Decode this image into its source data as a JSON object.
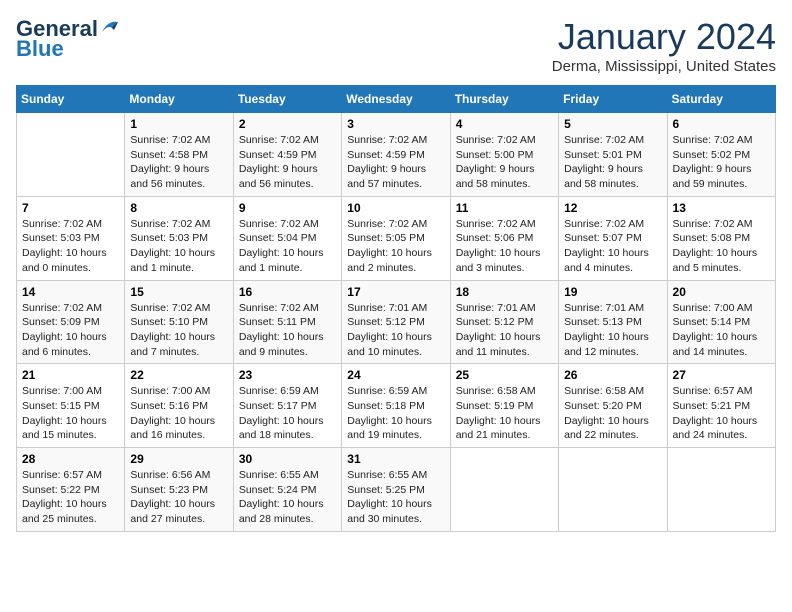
{
  "header": {
    "logo_line1": "General",
    "logo_line2": "Blue",
    "month": "January 2024",
    "location": "Derma, Mississippi, United States"
  },
  "weekdays": [
    "Sunday",
    "Monday",
    "Tuesday",
    "Wednesday",
    "Thursday",
    "Friday",
    "Saturday"
  ],
  "weeks": [
    [
      {
        "day": "",
        "sunrise": "",
        "sunset": "",
        "daylight": ""
      },
      {
        "day": "1",
        "sunrise": "7:02 AM",
        "sunset": "4:58 PM",
        "daylight": "9 hours and 56 minutes."
      },
      {
        "day": "2",
        "sunrise": "7:02 AM",
        "sunset": "4:59 PM",
        "daylight": "9 hours and 56 minutes."
      },
      {
        "day": "3",
        "sunrise": "7:02 AM",
        "sunset": "4:59 PM",
        "daylight": "9 hours and 57 minutes."
      },
      {
        "day": "4",
        "sunrise": "7:02 AM",
        "sunset": "5:00 PM",
        "daylight": "9 hours and 58 minutes."
      },
      {
        "day": "5",
        "sunrise": "7:02 AM",
        "sunset": "5:01 PM",
        "daylight": "9 hours and 58 minutes."
      },
      {
        "day": "6",
        "sunrise": "7:02 AM",
        "sunset": "5:02 PM",
        "daylight": "9 hours and 59 minutes."
      }
    ],
    [
      {
        "day": "7",
        "sunrise": "7:02 AM",
        "sunset": "5:03 PM",
        "daylight": "10 hours and 0 minutes."
      },
      {
        "day": "8",
        "sunrise": "7:02 AM",
        "sunset": "5:03 PM",
        "daylight": "10 hours and 1 minute."
      },
      {
        "day": "9",
        "sunrise": "7:02 AM",
        "sunset": "5:04 PM",
        "daylight": "10 hours and 1 minute."
      },
      {
        "day": "10",
        "sunrise": "7:02 AM",
        "sunset": "5:05 PM",
        "daylight": "10 hours and 2 minutes."
      },
      {
        "day": "11",
        "sunrise": "7:02 AM",
        "sunset": "5:06 PM",
        "daylight": "10 hours and 3 minutes."
      },
      {
        "day": "12",
        "sunrise": "7:02 AM",
        "sunset": "5:07 PM",
        "daylight": "10 hours and 4 minutes."
      },
      {
        "day": "13",
        "sunrise": "7:02 AM",
        "sunset": "5:08 PM",
        "daylight": "10 hours and 5 minutes."
      }
    ],
    [
      {
        "day": "14",
        "sunrise": "7:02 AM",
        "sunset": "5:09 PM",
        "daylight": "10 hours and 6 minutes."
      },
      {
        "day": "15",
        "sunrise": "7:02 AM",
        "sunset": "5:10 PM",
        "daylight": "10 hours and 7 minutes."
      },
      {
        "day": "16",
        "sunrise": "7:02 AM",
        "sunset": "5:11 PM",
        "daylight": "10 hours and 9 minutes."
      },
      {
        "day": "17",
        "sunrise": "7:01 AM",
        "sunset": "5:12 PM",
        "daylight": "10 hours and 10 minutes."
      },
      {
        "day": "18",
        "sunrise": "7:01 AM",
        "sunset": "5:12 PM",
        "daylight": "10 hours and 11 minutes."
      },
      {
        "day": "19",
        "sunrise": "7:01 AM",
        "sunset": "5:13 PM",
        "daylight": "10 hours and 12 minutes."
      },
      {
        "day": "20",
        "sunrise": "7:00 AM",
        "sunset": "5:14 PM",
        "daylight": "10 hours and 14 minutes."
      }
    ],
    [
      {
        "day": "21",
        "sunrise": "7:00 AM",
        "sunset": "5:15 PM",
        "daylight": "10 hours and 15 minutes."
      },
      {
        "day": "22",
        "sunrise": "7:00 AM",
        "sunset": "5:16 PM",
        "daylight": "10 hours and 16 minutes."
      },
      {
        "day": "23",
        "sunrise": "6:59 AM",
        "sunset": "5:17 PM",
        "daylight": "10 hours and 18 minutes."
      },
      {
        "day": "24",
        "sunrise": "6:59 AM",
        "sunset": "5:18 PM",
        "daylight": "10 hours and 19 minutes."
      },
      {
        "day": "25",
        "sunrise": "6:58 AM",
        "sunset": "5:19 PM",
        "daylight": "10 hours and 21 minutes."
      },
      {
        "day": "26",
        "sunrise": "6:58 AM",
        "sunset": "5:20 PM",
        "daylight": "10 hours and 22 minutes."
      },
      {
        "day": "27",
        "sunrise": "6:57 AM",
        "sunset": "5:21 PM",
        "daylight": "10 hours and 24 minutes."
      }
    ],
    [
      {
        "day": "28",
        "sunrise": "6:57 AM",
        "sunset": "5:22 PM",
        "daylight": "10 hours and 25 minutes."
      },
      {
        "day": "29",
        "sunrise": "6:56 AM",
        "sunset": "5:23 PM",
        "daylight": "10 hours and 27 minutes."
      },
      {
        "day": "30",
        "sunrise": "6:55 AM",
        "sunset": "5:24 PM",
        "daylight": "10 hours and 28 minutes."
      },
      {
        "day": "31",
        "sunrise": "6:55 AM",
        "sunset": "5:25 PM",
        "daylight": "10 hours and 30 minutes."
      },
      {
        "day": "",
        "sunrise": "",
        "sunset": "",
        "daylight": ""
      },
      {
        "day": "",
        "sunrise": "",
        "sunset": "",
        "daylight": ""
      },
      {
        "day": "",
        "sunrise": "",
        "sunset": "",
        "daylight": ""
      }
    ]
  ]
}
